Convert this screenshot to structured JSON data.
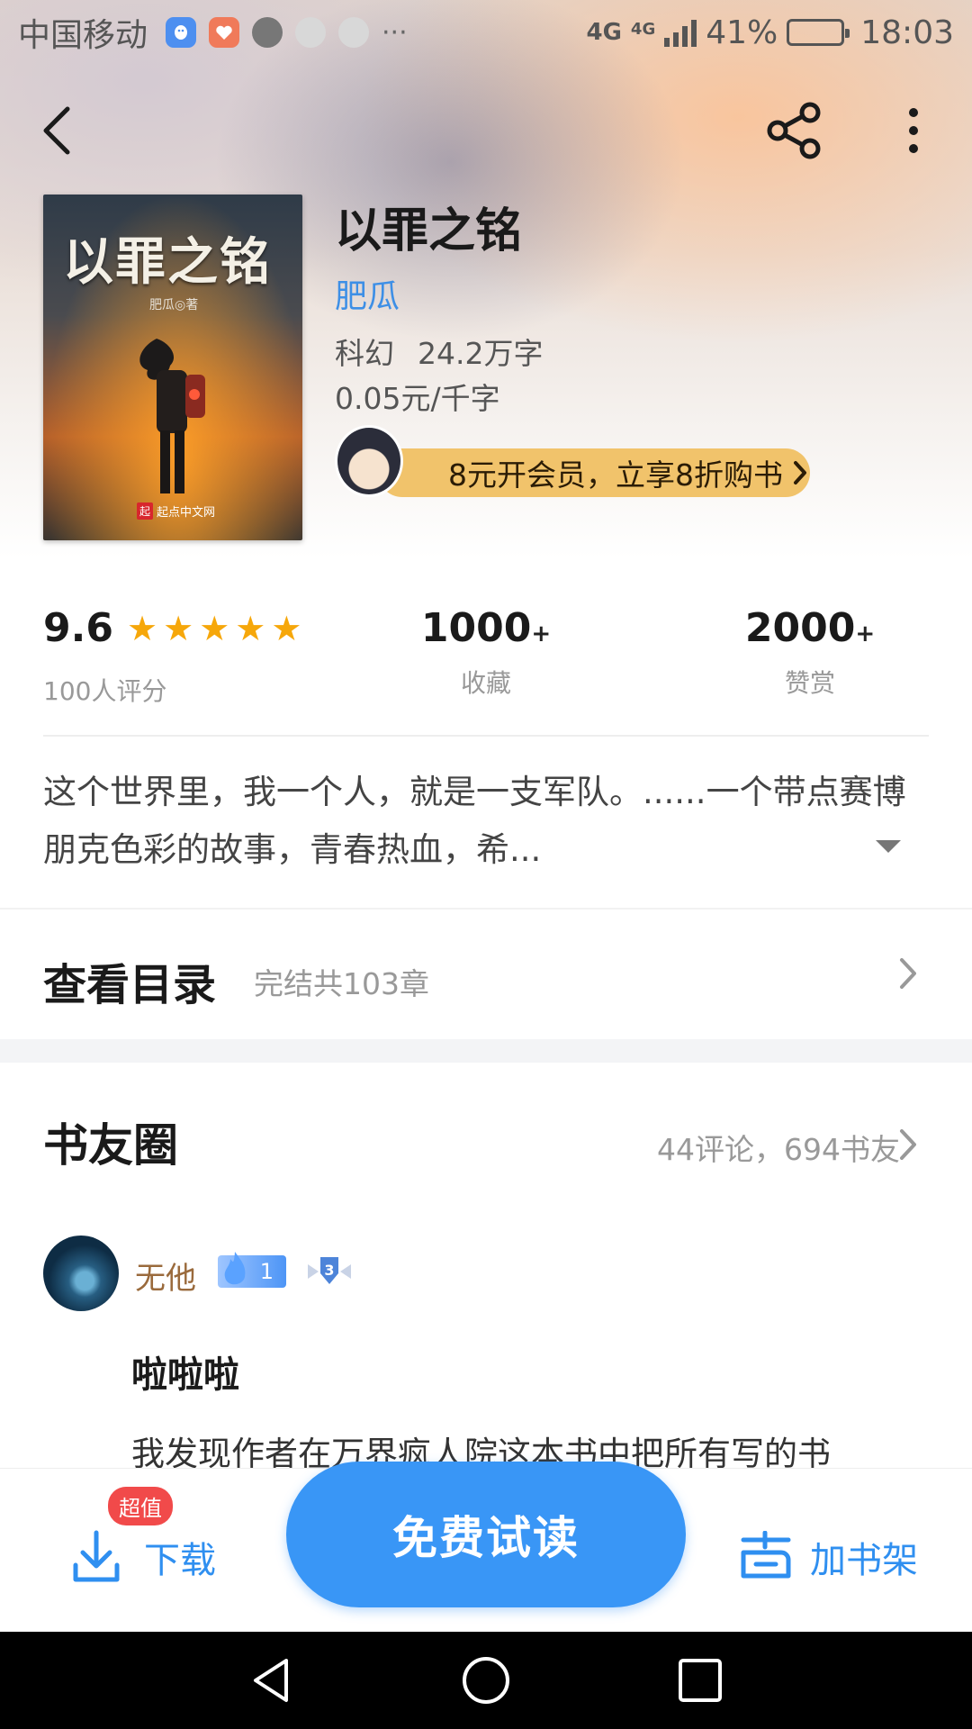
{
  "status_bar": {
    "carrier": "中国移动",
    "more": "···",
    "network_1": "4G",
    "network_2": "4G",
    "battery": "41%",
    "battery_level": 0.41,
    "time": "18:03"
  },
  "nav": {
    "back_icon": "chevron-left-icon",
    "share_icon": "share-icon",
    "more_icon": "more-vertical-icon"
  },
  "book": {
    "title": "以罪之铭",
    "author": "肥瓜",
    "category": "科幻",
    "word_count": "24.2万字",
    "price": "0.05元/千字",
    "cover_title": "以罪之铭",
    "cover_author": "肥瓜◎著",
    "cover_publisher_mark": "起",
    "cover_publisher": "起点中文网"
  },
  "vip_banner": {
    "text": "8元开会员，立享8折购书",
    "chevron": "›"
  },
  "stats": {
    "rating": "9.6",
    "rating_stars": 5,
    "rating_count": "100人评分",
    "favorites_value": "1000",
    "favorites_plus": "+",
    "favorites_label": "收藏",
    "rewards_value": "2000",
    "rewards_plus": "+",
    "rewards_label": "赞赏"
  },
  "synopsis": {
    "text": "这个世界里，我一个人，就是一支军队。......一个带点赛博朋克色彩的故事，青春热血，希..."
  },
  "toc": {
    "title": "查看目录",
    "subtitle": "完结共103章"
  },
  "circle": {
    "title": "书友圈",
    "meta": "44评论，694书友"
  },
  "comment": {
    "username": "无他",
    "fire_level": "1",
    "level_badge": "3",
    "title": "啦啦啦",
    "body": "我发现作者在万界疯人院这本书中把所有写的书"
  },
  "actions": {
    "download_badge": "超值",
    "download_label": "下载",
    "read_label": "免费试读",
    "shelf_label": "加书架"
  },
  "colors": {
    "accent": "#3996F6",
    "author_link": "#3D8FE6",
    "vip_banner": "#F1C36B",
    "star": "#F6A70A",
    "badge_red": "#F14A4A"
  }
}
